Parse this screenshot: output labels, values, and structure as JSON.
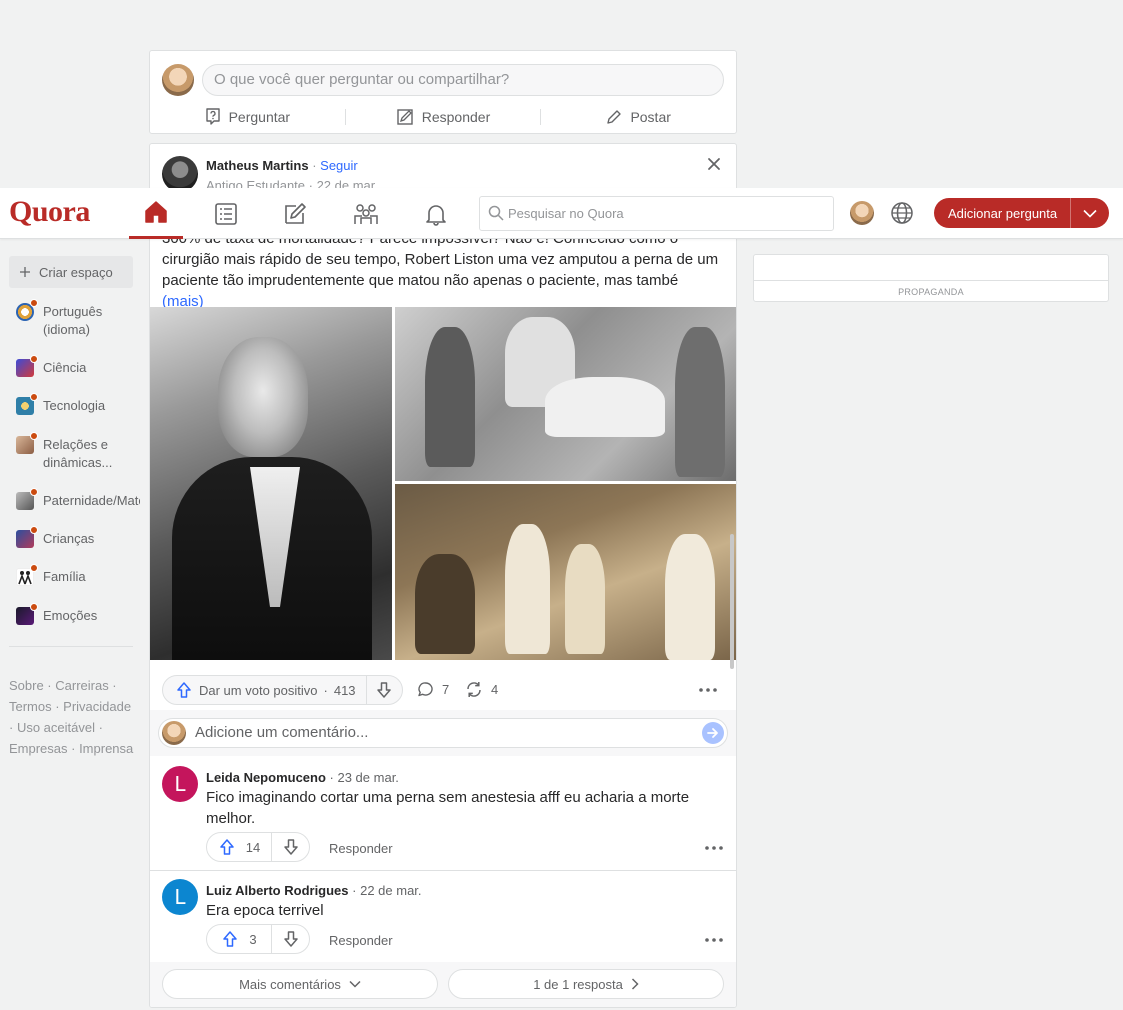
{
  "ask": {
    "placeholder": "O que você quer perguntar ou compartilhar?",
    "actions": [
      "Perguntar",
      "Responder",
      "Postar"
    ]
  },
  "post": {
    "author": "Matheus Martins",
    "follow": "Seguir",
    "credential": "Antigo Estudante · 22 de mar",
    "text": "300% de taxa de mortalidade? Parece impossível? Não é! Conhecido como o cirurgião mais rápido de seu tempo, Robert Liston uma vez amputou a perna de um paciente tão imprudentemente que matou não apenas o paciente, mas també",
    "more": "(mais)",
    "upvote_label": "Dar um voto positivo",
    "upvotes": "413",
    "comments": "7",
    "shares": "4",
    "comment_placeholder": "Adicione um comentário..."
  },
  "comments": [
    {
      "initial": "L",
      "name": "Leida Nepomuceno",
      "date": "· 23 de mar.",
      "text": "Fico imaginando cortar uma perna sem anestesia afff eu acharia a morte melhor.",
      "upvotes": "14",
      "reply": "Responder",
      "color": "#c4155c"
    },
    {
      "initial": "L",
      "name": "Luiz Alberto Rodrigues",
      "date": "· 22 de mar.",
      "text": "Era epoca terrivel",
      "upvotes": "3",
      "reply": "Responder",
      "color": "#0c86d0"
    }
  ],
  "footer": {
    "more_comments": "Mais comentários",
    "answers": "1 de 1 resposta"
  },
  "header": {
    "logo": "Quora",
    "search_placeholder": "Pesquisar no Quora",
    "add_question": "Adicionar pergunta",
    "brand_color": "#b92b27"
  },
  "sidebar": {
    "create": "Criar espaço",
    "items": [
      {
        "label": "Português (idioma)",
        "color": "#e0a23a"
      },
      {
        "label": "Ciência",
        "color": "#3b4bd8"
      },
      {
        "label": "Tecnologia",
        "color": "#2f7fa8"
      },
      {
        "label": "Relações e dinâmicas...",
        "color": "#b9896a"
      },
      {
        "label": "Paternidade/Maternidade",
        "color": "#8a8a8a"
      },
      {
        "label": "Crianças",
        "color": "#2b4fa0"
      },
      {
        "label": "Família",
        "color": "#222222"
      },
      {
        "label": "Emoções",
        "color": "#5a1a78"
      }
    ],
    "links": "Sobre · Carreiras · Termos · Privacidade · Uso aceitável · Empresas · Imprensa"
  },
  "ad": {
    "label": "PROPAGANDA"
  }
}
